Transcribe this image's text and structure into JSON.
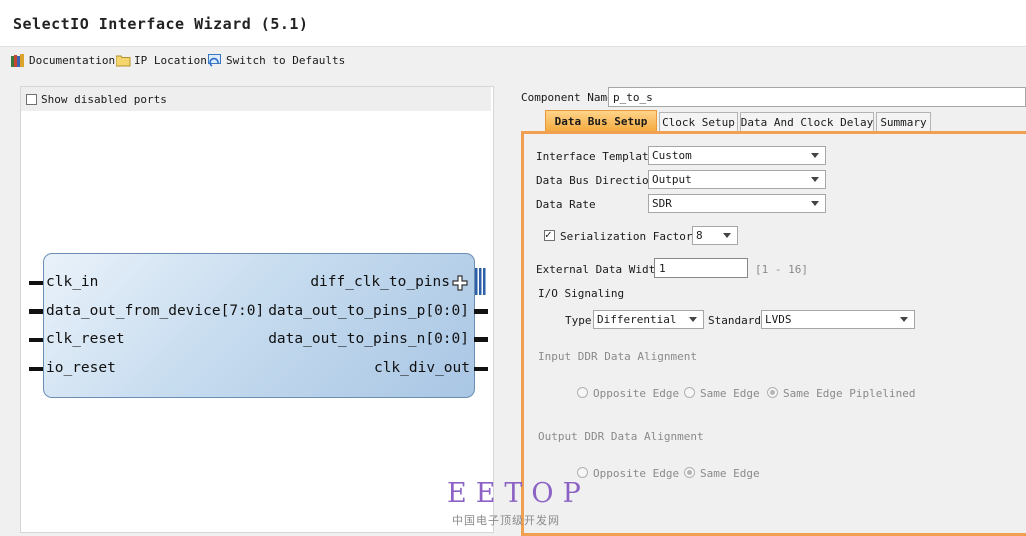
{
  "window": {
    "title": "SelectIO Interface Wizard (5.1)"
  },
  "toolbar": {
    "documentation": "Documentation",
    "ip_location": "IP Location",
    "switch_defaults": "Switch to Defaults"
  },
  "left": {
    "show_disabled_ports": "Show disabled ports",
    "ports_left": [
      "clk_in",
      "data_out_from_device[7:0]",
      "clk_reset",
      "io_reset"
    ],
    "ports_right": [
      "diff_clk_to_pins",
      "data_out_to_pins_p[0:0]",
      "data_out_to_pins_n[0:0]",
      "clk_div_out"
    ]
  },
  "component": {
    "label": "Component Name",
    "value": "p_to_s"
  },
  "tabs": [
    "Data Bus Setup",
    "Clock Setup",
    "Data And Clock Delay",
    "Summary"
  ],
  "form": {
    "interface_template": {
      "label": "Interface Template",
      "value": "Custom"
    },
    "data_bus_direction": {
      "label": "Data Bus Direction",
      "value": "Output"
    },
    "data_rate": {
      "label": "Data Rate",
      "value": "SDR"
    },
    "serialization_factor": {
      "label": "Serialization Factor",
      "value": "8",
      "checked": true
    },
    "external_data_width": {
      "label": "External Data Width",
      "value": "1",
      "range": "[1 - 16]"
    },
    "io_signaling": {
      "label": "I/O Signaling",
      "type_label": "Type",
      "type_value": "Differential",
      "standard_label": "Standard",
      "standard_value": "LVDS"
    },
    "input_ddr": {
      "label": "Input DDR Data Alignment",
      "options": [
        "Opposite Edge",
        "Same Edge",
        "Same Edge Piplelined"
      ],
      "selected": 2
    },
    "output_ddr": {
      "label": "Output DDR Data Alignment",
      "options": [
        "Opposite Edge",
        "Same Edge"
      ],
      "selected": 1
    }
  },
  "watermark": {
    "main": "EETOP",
    "sub": "中国电子顶级开发网"
  },
  "colors": {
    "active_tab": "#f4a83c",
    "block_fill": "#c7dcef",
    "watermark": "#8c63c4"
  }
}
